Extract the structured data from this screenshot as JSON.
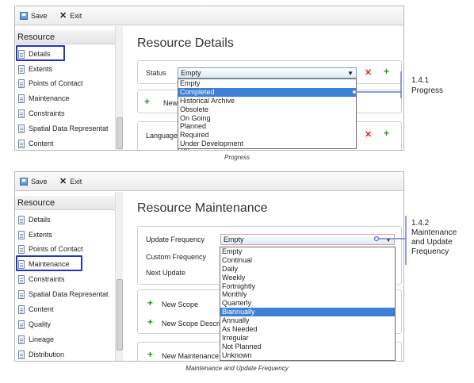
{
  "top": {
    "toolbar": {
      "save_label": "Save",
      "exit_label": "Exit"
    },
    "sidebar": {
      "header": "Resource",
      "items": [
        "Details",
        "Extents",
        "Points of Contact",
        "Maintenance",
        "Constraints",
        "Spatial Data Representat",
        "Content"
      ]
    },
    "page_title": "Resource Details",
    "status": {
      "label": "Status",
      "value": "Empty"
    },
    "new_label": "New",
    "language": {
      "label": "Language",
      "label2": "Lan"
    },
    "dropdown_options": [
      "Empty",
      "Completed",
      "Historical Archive",
      "Obsolete",
      "On Going",
      "Planned",
      "Required",
      "Under Development"
    ],
    "selected_option": "Completed",
    "callout": {
      "number": "1.4.1",
      "text": "Progress"
    },
    "caption": "Progress"
  },
  "bottom": {
    "toolbar": {
      "save_label": "Save",
      "exit_label": "Exit"
    },
    "sidebar": {
      "header": "Resource",
      "items": [
        "Details",
        "Extents",
        "Points of Contact",
        "Maintenance",
        "Constraints",
        "Spatial Data Representat",
        "Content",
        "Quality",
        "Lineage",
        "Distribution"
      ]
    },
    "page_title": "Resource Maintenance",
    "update_frequency": {
      "label": "Update Frequency",
      "value": "Empty"
    },
    "custom_frequency_label": "Custom Frequency",
    "next_update_label": "Next Update",
    "new_scope_label": "New Scope",
    "new_scope_desc_label": "New Scope Descri",
    "new_maintenance_label": "New Maintenance",
    "dropdown_options": [
      "Empty",
      "Continual",
      "Daily",
      "Weekly",
      "Fortnightly",
      "Monthly",
      "Quarterly",
      "Biannually",
      "Annually",
      "As Needed",
      "Irregular",
      "Not Planned",
      "Unknown"
    ],
    "selected_option": "Biannually",
    "callout": {
      "number": "1.4.2",
      "line1": "Maintenance",
      "line2": "and Update",
      "line3": "Frequency"
    },
    "caption": "Maintenance and Update Frequency"
  }
}
